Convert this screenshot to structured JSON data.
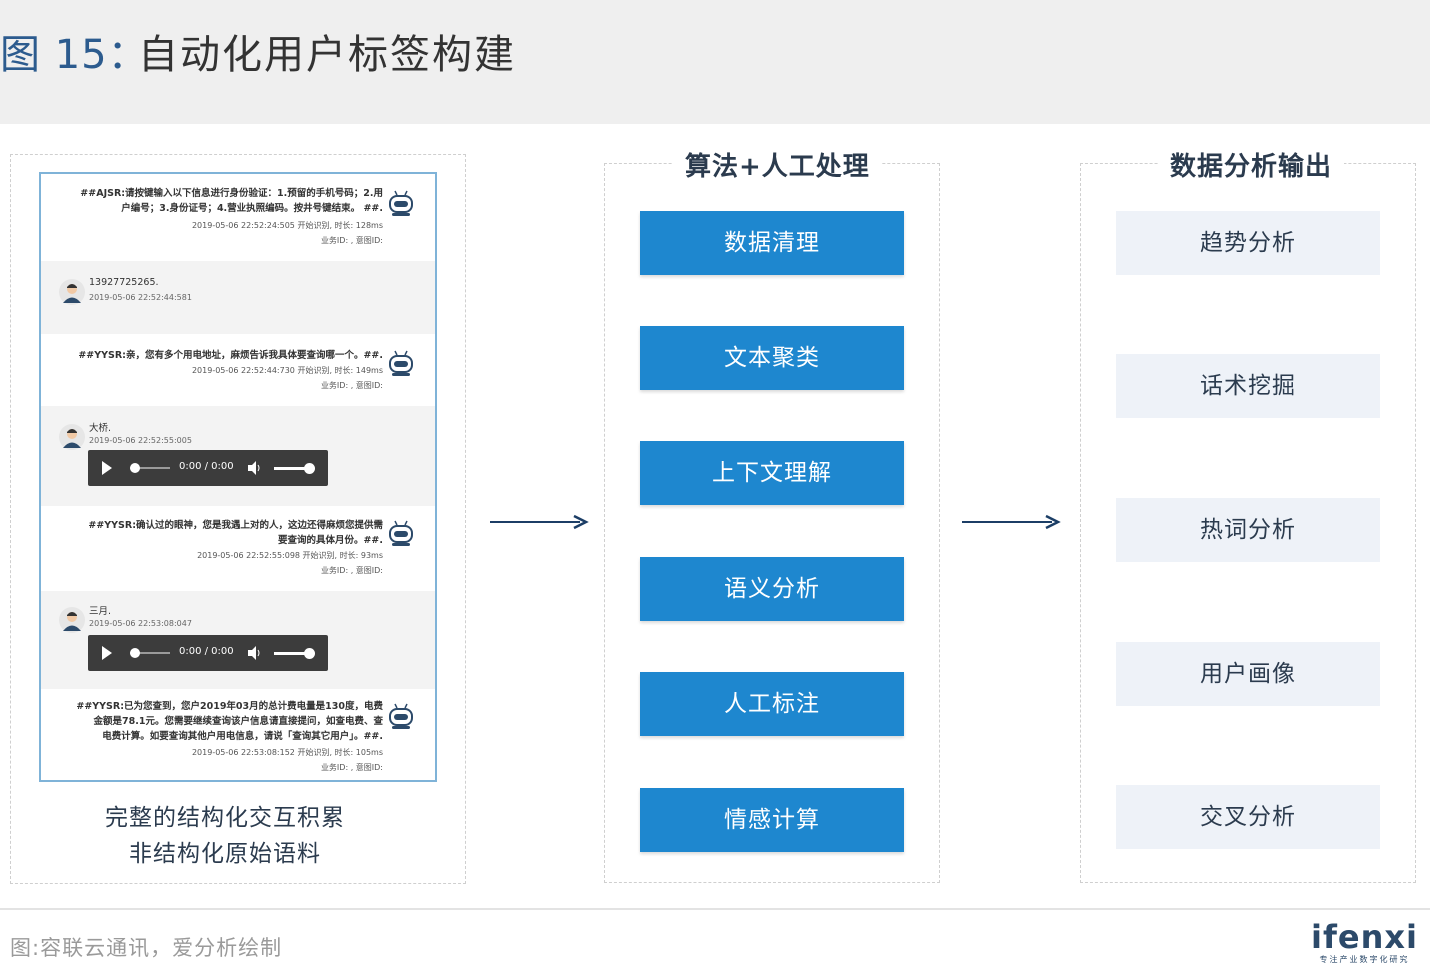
{
  "header": {
    "figure_label": "图 15：",
    "title": "自动化用户标签构建"
  },
  "chat_panel": {
    "messages": [
      {
        "role": "bot",
        "text_lines": [
          "##AJSR:请按键输入以下信息进行身份验证：1.预留的手机号码；2.用",
          "户编号；3.身份证号；4.营业执照编码。按井号键结束。 ##."
        ],
        "timing": "2019-05-06 22:52:24:505 开始识别, 时长: 128ms",
        "ids": "业务ID: , 意图ID:"
      },
      {
        "role": "user",
        "text": "13927725265.",
        "time": "2019-05-06 22:52:44:581"
      },
      {
        "role": "bot",
        "text_lines": [
          "##YYSR:亲，您有多个用电地址，麻烦告诉我具体要查询哪一个。##."
        ],
        "timing": "2019-05-06 22:52:44:730 开始识别, 时长: 149ms",
        "ids": "业务ID: , 意图ID:"
      },
      {
        "role": "user",
        "text": "大桥.",
        "time": "2019-05-06 22:52:55:005",
        "audio": "0:00 / 0:00"
      },
      {
        "role": "bot",
        "text_lines": [
          "##YYSR:确认过的眼神，您是我遇上对的人，这边还得麻烦您提供需",
          "要查询的具体月份。##."
        ],
        "timing": "2019-05-06 22:52:55:098 开始识别, 时长: 93ms",
        "ids": "业务ID: , 意图ID:"
      },
      {
        "role": "user",
        "text": "三月.",
        "time": "2019-05-06 22:53:08:047",
        "audio": "0:00 / 0:00"
      },
      {
        "role": "bot",
        "text_lines": [
          "##YYSR:已为您查到，您户2019年03月的总计费电量是130度，电费",
          "金额是78.1元。您需要继续查询该户信息请直接提问，如查电费、查",
          "电费计算。如要查询其他户用电信息，请说「查询其它用户」。##."
        ],
        "timing": "2019-05-06 22:53:08:152 开始识别, 时长: 105ms",
        "ids": "业务ID: , 意图ID:"
      }
    ],
    "caption_line1": "完整的结构化交互积累",
    "caption_line2": "非结构化原始语料"
  },
  "process_panel": {
    "title": "算法+人工处理",
    "steps": [
      "数据清理",
      "文本聚类",
      "上下文理解",
      "语义分析",
      "人工标注",
      "情感计算"
    ]
  },
  "output_panel": {
    "title": "数据分析输出",
    "items": [
      "趋势分析",
      "话术挖掘",
      "热词分析",
      "用户画像",
      "交叉分析"
    ]
  },
  "footer": {
    "source": "图:容联云通讯，爱分析绘制",
    "logo": "ifenxi",
    "logo_sub": "专注产业数字化研究"
  },
  "colors": {
    "accent_blue": "#1e87cf",
    "title_blue": "#2c5b8e",
    "output_bg": "#eef2f8",
    "arrow": "#1c3e66"
  }
}
